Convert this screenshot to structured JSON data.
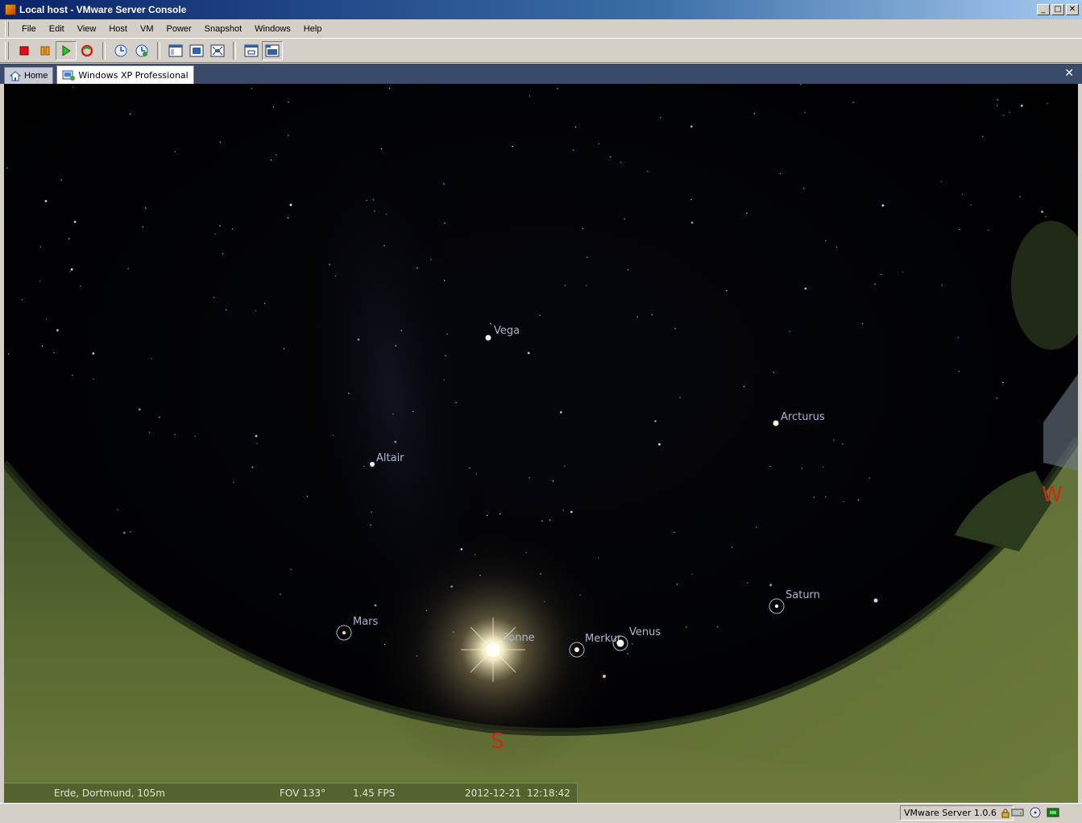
{
  "window": {
    "title": "Local host - VMware Server Console",
    "minimize": "_",
    "maximize": "□",
    "close": "✕"
  },
  "menu": [
    "File",
    "Edit",
    "View",
    "Host",
    "VM",
    "Power",
    "Snapshot",
    "Windows",
    "Help"
  ],
  "toolbar": [
    "stop-icon",
    "pause-icon",
    "play-icon",
    "reset-icon",
    "snapshot-icon",
    "revert-snapshot-icon",
    "summary-view-icon",
    "console-view-icon",
    "fullscreen-icon",
    "quick-switch-icon",
    "tabbed-view-icon"
  ],
  "tabs": [
    {
      "label": "Home",
      "icon": "home-icon",
      "active": false
    },
    {
      "label": "Windows XP Professional",
      "icon": "vm-icon",
      "active": true
    }
  ],
  "tab_close": "✕",
  "sky": {
    "stars": [
      {
        "label": "Vega"
      },
      {
        "label": "Altair"
      },
      {
        "label": "Arcturus"
      }
    ],
    "planets": [
      {
        "label": "Mars"
      },
      {
        "label": "Sonne"
      },
      {
        "label": "Merkur"
      },
      {
        "label": "Venus"
      },
      {
        "label": "Saturn"
      }
    ],
    "compass": {
      "south": "S",
      "west": "W"
    }
  },
  "stellarium_status": {
    "location": "Erde, Dortmund, 105m",
    "fov": "FOV 133°",
    "fps": "1.45 FPS",
    "date": "2012-12-21",
    "time": "12:18:42"
  },
  "statusbar": {
    "version": "VMware Server 1.0.6",
    "icons": [
      "lock-icon",
      "hard-disk-icon",
      "cdrom-icon",
      "network-icon"
    ]
  },
  "colors": {
    "title_start": "#0a246a",
    "title_end": "#a6caf0",
    "tabbar": "#3a4a6a",
    "compass": "#cc2a10"
  }
}
